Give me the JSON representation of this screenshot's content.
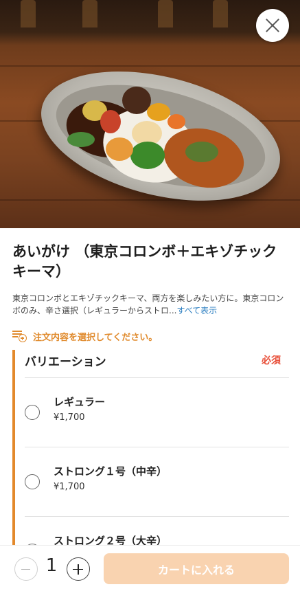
{
  "hero": {
    "alt": "curry plate photo"
  },
  "product": {
    "title": "あいがけ （東京コロンボ＋エキゾチックキーマ）",
    "description": "東京コロンボとエキゾチックキーマ、両方を楽しみたい方に。東京コロンボのみ、辛さ選択（レギュラーからストロ...",
    "more_link": "すべて表示"
  },
  "notice": {
    "text": "注文内容を選択してください。"
  },
  "variation": {
    "title": "バリエーション",
    "required": "必須",
    "options": [
      {
        "name": "レギュラー",
        "price": "¥1,700"
      },
      {
        "name": "ストロング１号（中辛）",
        "price": "¥1,700"
      },
      {
        "name": "ストロング２号（大辛）",
        "price": ""
      }
    ]
  },
  "footer": {
    "quantity": "1",
    "cart_label": "カートに入れる"
  },
  "colors": {
    "accent": "#e3892b",
    "required": "#e8503a",
    "link": "#2d7fc1",
    "cart_disabled": "#f9d3b0"
  }
}
